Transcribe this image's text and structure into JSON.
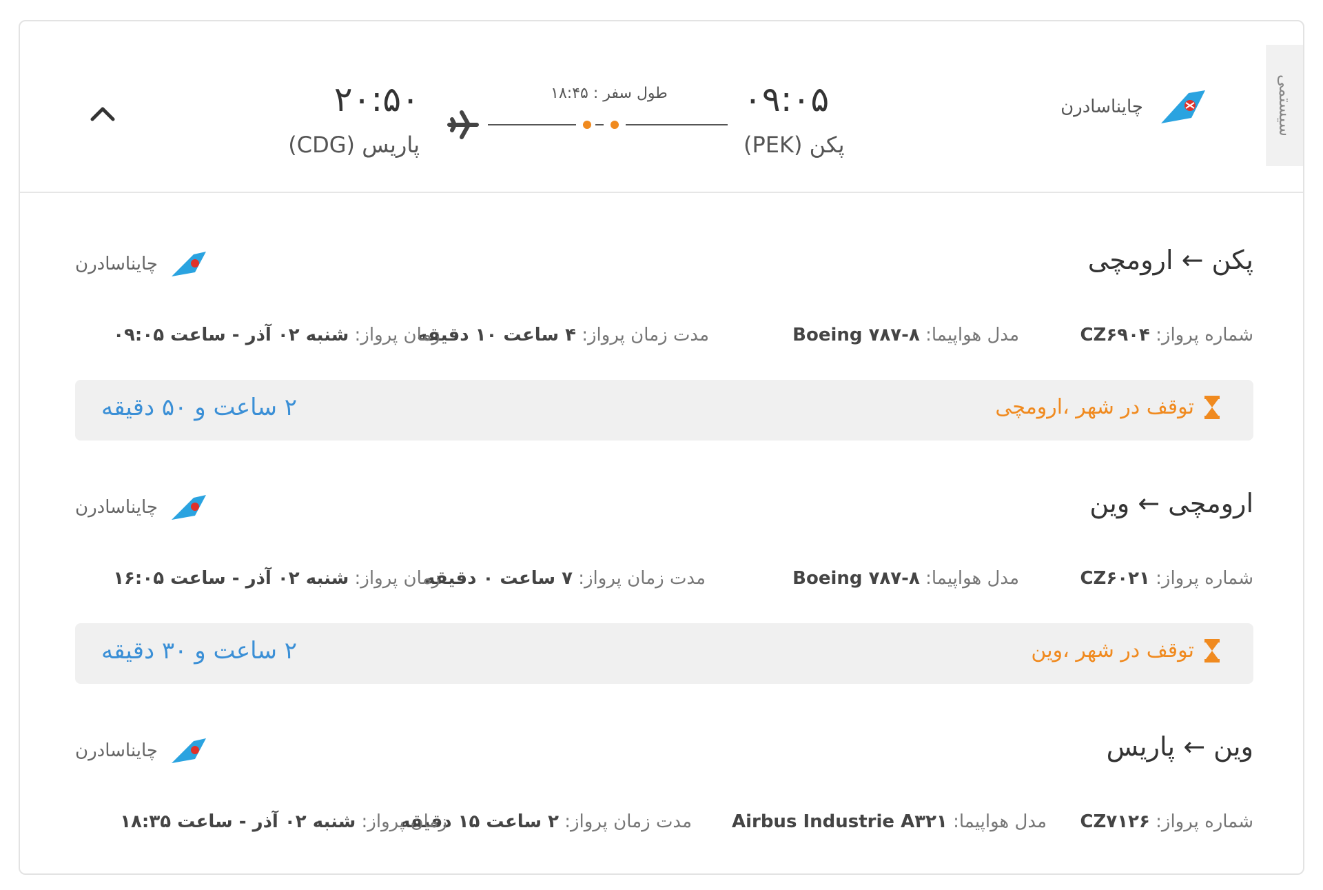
{
  "summary": {
    "system_tab": "سیستمی",
    "airline": "چایناسادرن",
    "departure_time": "۰۹:۰۵",
    "departure_city": "پکن (PEK)",
    "arrival_time": "۲۰:۵۰",
    "arrival_city": "پاریس (CDG)",
    "duration_label": "طول سفر : ۱۸:۴۵",
    "stops_count": 2
  },
  "labels": {
    "flight_number": "شماره پرواز:",
    "aircraft_model": "مدل هواپیما:",
    "flight_duration": "مدت زمان پرواز:",
    "flight_time": "زمان پرواز:"
  },
  "segments": [
    {
      "route": "پکن ← ارومچی",
      "airline": "چایناسادرن",
      "flight_number": "CZ۶۹۰۴",
      "aircraft": "Boeing ۷۸۷-۸",
      "duration": "۴ ساعت ۱۰ دقیقه",
      "time": "شنبه ۰۲ آذر - ساعت ۰۹:۰۵",
      "layover": {
        "label": "توقف در شهر ،ارومچی",
        "time": "۲ ساعت و ۵۰ دقیقه"
      }
    },
    {
      "route": "ارومچی ← وین",
      "airline": "چایناسادرن",
      "flight_number": "CZ۶۰۲۱",
      "aircraft": "Boeing ۷۸۷-۸",
      "duration": "۷ ساعت ۰ دقیقه",
      "time": "شنبه ۰۲ آذر - ساعت ۱۶:۰۵",
      "layover": {
        "label": "توقف در شهر ،وین",
        "time": "۲ ساعت و ۳۰ دقیقه"
      }
    },
    {
      "route": "وین ← پاریس",
      "airline": "چایناسادرن",
      "flight_number": "CZ۷۱۲۶",
      "aircraft": "Airbus Industrie A۳۲۱",
      "duration": "۲ ساعت ۱۵ دقیقه",
      "time": "شنبه ۰۲ آذر - ساعت ۱۸:۳۵"
    }
  ],
  "icons": {
    "airline_logo": "china-southern-logo-icon",
    "plane": "airplane-icon",
    "collapse": "chevron-up-icon",
    "layover": "hourglass-icon"
  },
  "colors": {
    "accent_orange": "#f08a1f",
    "layover_time_blue": "#3a8fd6",
    "logo_blue": "#2aa3e0",
    "logo_red": "#e0312a"
  }
}
